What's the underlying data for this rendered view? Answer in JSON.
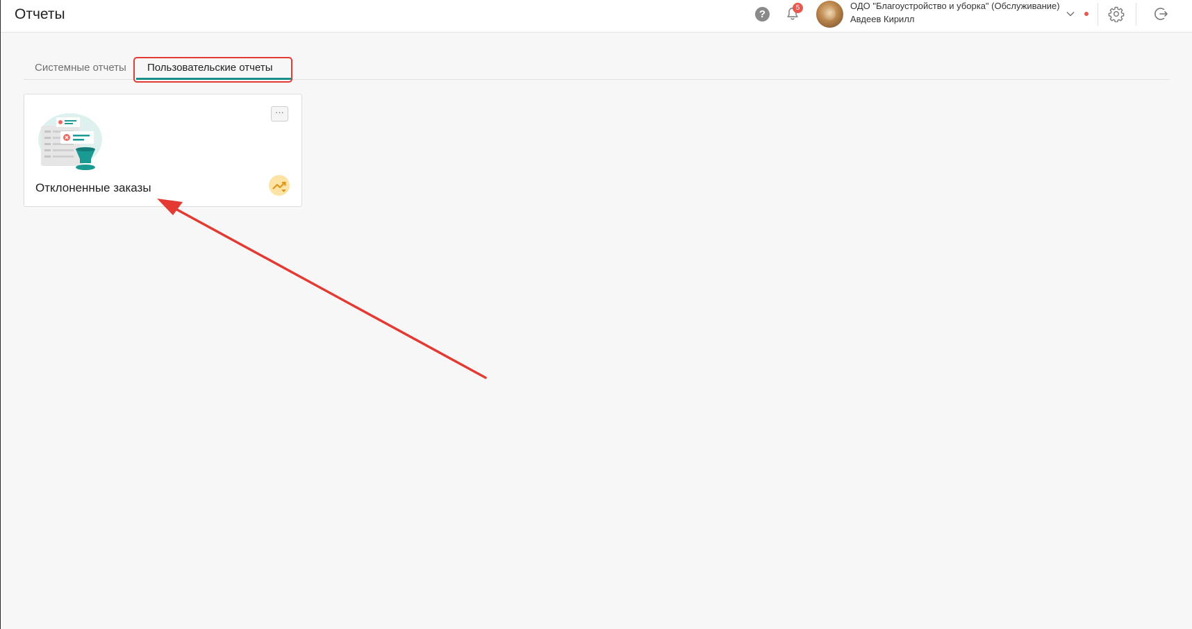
{
  "header": {
    "title": "Отчеты",
    "help_glyph": "?",
    "notifications_count": "5",
    "org_name": "ОДО \"Благоустройство и уборка\" (Обслуживание)",
    "user_name": "Авдеев Кирилл",
    "status_color": "#e8584f"
  },
  "tabs": [
    {
      "label": "Системные отчеты",
      "active": false
    },
    {
      "label": "Пользовательские отчеты",
      "active": true
    }
  ],
  "reports": [
    {
      "title": "Отклоненные заказы",
      "icon": "analytics-icon",
      "more_glyph": "···"
    }
  ],
  "colors": {
    "accent": "#1a8f89",
    "annotation": "#e33b33",
    "badge": "#e8584f",
    "analytics_bg": "#fde4a6",
    "analytics_fg": "#e0961a"
  }
}
